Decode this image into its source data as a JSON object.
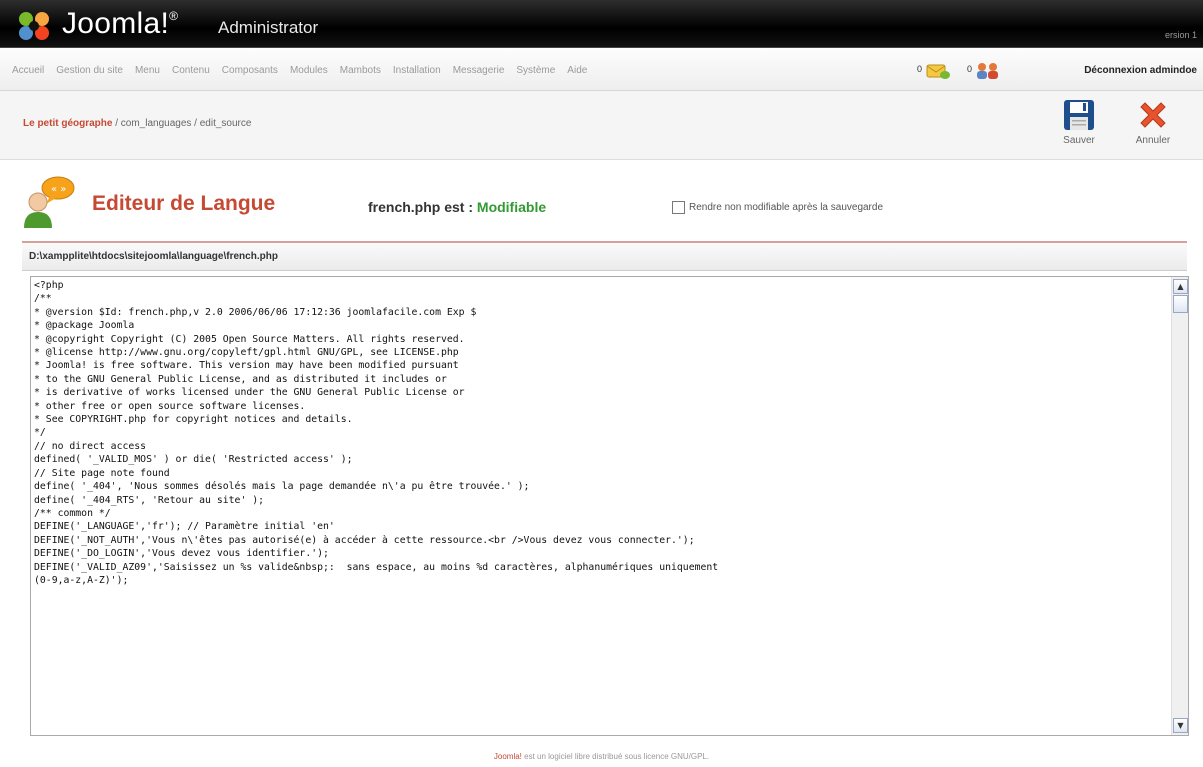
{
  "header": {
    "logo_text": "Joomla!",
    "logo_sup": "®",
    "subtitle": "Administrator",
    "version": "ersion 1"
  },
  "menu": {
    "items": [
      "Accueil",
      "Gestion du site",
      "Menu",
      "Contenu",
      "Composants",
      "Modules",
      "Mambots",
      "Installation",
      "Messagerie",
      "Système",
      "Aide"
    ],
    "messages_count": "0",
    "users_count": "0",
    "logout_label": "Déconnexion admindoe"
  },
  "toolbar": {
    "site_name": "Le petit géographe",
    "path": " / com_languages / edit_source",
    "save_label": "Sauver",
    "cancel_label": "Annuler"
  },
  "editor": {
    "title": "Editeur de Langue",
    "file_name": "french.php est : ",
    "status": "Modifiable",
    "checkbox_label": "Rendre non modifiable après la sauvegarde",
    "file_path": "D:\\xampplite\\htdocs\\sitejoomla\\language\\french.php",
    "code_lines": [
      "<?php",
      "/**",
      "* @version $Id: french.php,v 2.0 2006/06/06 17:12:36 joomlafacile.com Exp $",
      "* @package Joomla",
      "* @copyright Copyright (C) 2005 Open Source Matters. All rights reserved.",
      "* @license http://www.gnu.org/copyleft/gpl.html GNU/GPL, see LICENSE.php",
      "* Joomla! is free software. This version may have been modified pursuant",
      "* to the GNU General Public License, and as distributed it includes or",
      "* is derivative of works licensed under the GNU General Public License or",
      "* other free or open source software licenses.",
      "* See COPYRIGHT.php for copyright notices and details.",
      "*/",
      "",
      "// no direct access",
      "defined( '_VALID_MOS' ) or die( 'Restricted access' );",
      "",
      "// Site page note found",
      "define( '_404', 'Nous sommes désolés mais la page demandée n\\'a pu être trouvée.' );",
      "define( '_404_RTS', 'Retour au site' );",
      "",
      "/** common */",
      "DEFINE('_LANGUAGE','fr'); // Paramètre initial 'en'",
      "DEFINE('_NOT_AUTH','Vous n\\'êtes pas autorisé(e) à accéder à cette ressource.<br />Vous devez vous connecter.');",
      "DEFINE('_DO_LOGIN','Vous devez vous identifier.');",
      "DEFINE('_VALID_AZ09','Saisissez un %s valide&nbsp;:  sans espace, au moins %d caractères, alphanumériques uniquement",
      "(0-9,a-z,A-Z)');"
    ]
  },
  "footer": {
    "link": "Joomla!",
    "text": " est un logiciel libre distribué sous licence GNU/GPL."
  }
}
